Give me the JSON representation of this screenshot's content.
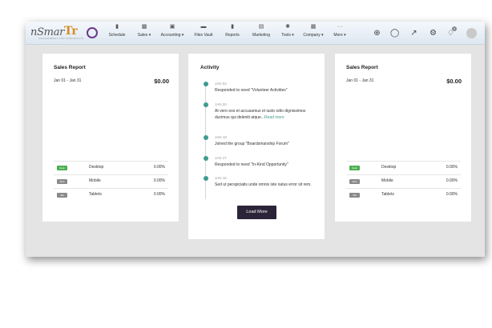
{
  "app": {
    "logo_word1": "nSmar",
    "logo_word2": "Tr",
    "logo_tagline": "MANAGEMENT FOR NONPROFITS"
  },
  "nav": [
    {
      "label": "Schedule",
      "icon": "bookmark-icon"
    },
    {
      "label": "Sales ▾",
      "icon": "bar-chart-icon"
    },
    {
      "label": "Accounting ▾",
      "icon": "money-icon"
    },
    {
      "label": "Files Vault",
      "icon": "folder-icon"
    },
    {
      "label": "Reports",
      "icon": "bookmark-icon"
    },
    {
      "label": "Marketing",
      "icon": "document-icon"
    },
    {
      "label": "Tools ▾",
      "icon": "gear-icon"
    },
    {
      "label": "Company ▾",
      "icon": "building-icon"
    },
    {
      "label": "More ▾",
      "icon": "dots-icon"
    }
  ],
  "header_icons": [
    "plus-circle-icon",
    "chat-icon",
    "trend-icon",
    "gear-icon",
    "bell-icon",
    "avatar"
  ],
  "notification_count": "1",
  "sales_left": {
    "title": "Sales Report",
    "range": "Jan 01 - Jan 31",
    "total": "$0.00",
    "rows": [
      {
        "tag": "Desk",
        "tag_color": "#4caf50",
        "device": "Desktop",
        "pct": "0.00%"
      },
      {
        "tag": "Mob",
        "tag_color": "#8a8a8a",
        "device": "Mobile",
        "pct": "0.00%"
      },
      {
        "tag": "Tab",
        "tag_color": "#8a8a8a",
        "device": "Tablets",
        "pct": "0.00%"
      }
    ]
  },
  "activity": {
    "title": "Activity",
    "items": [
      {
        "date": "JAN 02",
        "text": "Responded to need \"Volunteer Activities\"",
        "more": ""
      },
      {
        "date": "JAN 20",
        "text": "At vero eos et accusamus et iusto odio dignissimos ducimus qui deleniti atque...",
        "more": "Read more"
      },
      {
        "date": "JAN 19",
        "text": "Joined the group \"Boardsmanship Forum\"",
        "more": ""
      },
      {
        "date": "JAN 17",
        "text": "Responded to need \"In-Kind Opportunity\"",
        "more": ""
      },
      {
        "date": "JAN 16",
        "text": "Sed ut perspiciatis unde omnis iste natus error sit rem.",
        "more": ""
      }
    ],
    "button": "Load More"
  },
  "sales_right": {
    "title": "Sales Report",
    "range": "Jan 01 - Jan 31",
    "total": "$0.00",
    "rows": [
      {
        "tag": "Desk",
        "tag_color": "#4caf50",
        "device": "Desktop",
        "pct": "0.00%"
      },
      {
        "tag": "Mob",
        "tag_color": "#8a8a8a",
        "device": "Mobile",
        "pct": "0.00%"
      },
      {
        "tag": "Tab",
        "tag_color": "#8a8a8a",
        "device": "Tablets",
        "pct": "0.00%"
      }
    ]
  },
  "colors": {
    "accent": "#3e9b8f",
    "button": "#2c2438",
    "logo_orange": "#d98a1f",
    "logo_purple": "#6a3a8a"
  }
}
